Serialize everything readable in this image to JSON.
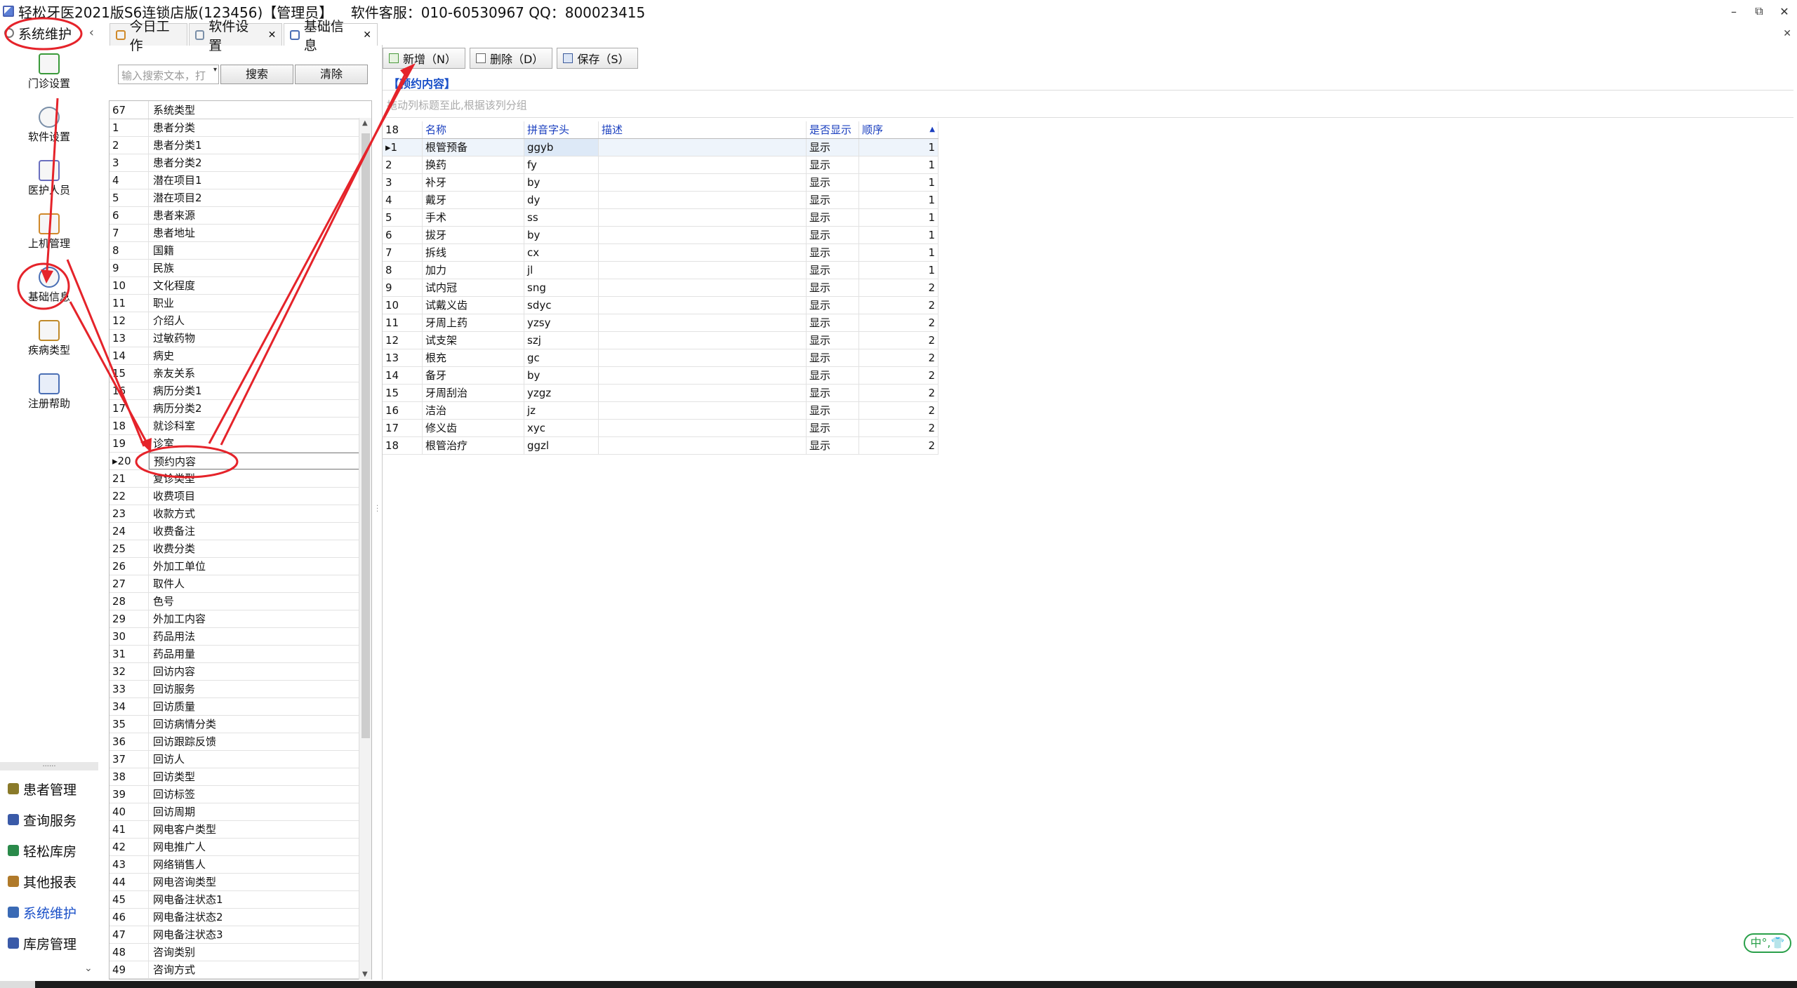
{
  "window": {
    "title": "轻松牙医2021版S6连锁店版(123456)【管理员】    软件客服：010-60530967 QQ：800023415",
    "minimize": "–",
    "restore": "⧉",
    "close": "✕"
  },
  "leftnav": {
    "header": "系统维护",
    "collapse": "‹",
    "tiles": [
      {
        "label": "门诊设置",
        "icon": "house-icon"
      },
      {
        "label": "软件设置",
        "icon": "gear-icon"
      },
      {
        "label": "医护人员",
        "icon": "staff-icon"
      },
      {
        "label": "上机管理",
        "icon": "lock-icon"
      },
      {
        "label": "基础信息",
        "icon": "basic-info-gear-icon"
      },
      {
        "label": "疾病类型",
        "icon": "tree-icon"
      },
      {
        "label": "注册帮助",
        "icon": "help-icon"
      }
    ],
    "splitter": "......",
    "groups": [
      {
        "label": "患者管理",
        "icon": "patients-icon"
      },
      {
        "label": "查询服务",
        "icon": "query-icon"
      },
      {
        "label": "轻松库房",
        "icon": "warehouse-icon"
      },
      {
        "label": "其他报表",
        "icon": "report-icon"
      },
      {
        "label": "系统维护",
        "icon": "maintenance-icon"
      },
      {
        "label": "库房管理",
        "icon": "storage-icon"
      }
    ],
    "more": "⌄"
  },
  "tabs": [
    {
      "label": "今日工作",
      "closable": false
    },
    {
      "label": "软件设置",
      "closable": true
    },
    {
      "label": "基础信息",
      "closable": true
    }
  ],
  "tab_close": "✕",
  "search": {
    "placeholder": "输入搜索文本，打",
    "search_label": "搜索",
    "clear_label": "清除"
  },
  "type_list": {
    "count": "67",
    "header": "系统类型",
    "items": [
      "患者分类",
      "患者分类1",
      "患者分类2",
      "潜在项目1",
      "潜在项目2",
      "患者来源",
      "患者地址",
      "国籍",
      "民族",
      "文化程度",
      "职业",
      "介绍人",
      "过敏药物",
      "病史",
      "亲友关系",
      "病历分类1",
      "病历分类2",
      "就诊科室",
      "诊室",
      "预约内容",
      "复诊类型",
      "收费项目",
      "收款方式",
      "收费备注",
      "收费分类",
      "外加工单位",
      "取件人",
      "色号",
      "外加工内容",
      "药品用法",
      "药品用量",
      "回访内容",
      "回访服务",
      "回访质量",
      "回访病情分类",
      "回访跟踪反馈",
      "回访人",
      "回访类型",
      "回访标签",
      "回访周期",
      "网电客户类型",
      "网电推广人",
      "网络销售人",
      "网电咨询类型",
      "网电备注状态1",
      "网电备注状态2",
      "网电备注状态3",
      "咨询类别",
      "咨询方式"
    ],
    "selected_index": 20
  },
  "toolbar": {
    "add": "新增（N）",
    "delete": "删除（D）",
    "save": "保存（S）"
  },
  "section_title": "【预约内容】",
  "group_hint": "拖动列标题至此,根据该列分组",
  "grid": {
    "count": "18",
    "columns": [
      "名称",
      "拼音字头",
      "描述",
      "是否显示",
      "顺序"
    ],
    "rows": [
      [
        "1",
        "根管预备",
        "ggyb",
        "",
        "显示",
        "1"
      ],
      [
        "2",
        "换药",
        "fy",
        "",
        "显示",
        "1"
      ],
      [
        "3",
        "补牙",
        "by",
        "",
        "显示",
        "1"
      ],
      [
        "4",
        "戴牙",
        "dy",
        "",
        "显示",
        "1"
      ],
      [
        "5",
        "手术",
        "ss",
        "",
        "显示",
        "1"
      ],
      [
        "6",
        "拔牙",
        "by",
        "",
        "显示",
        "1"
      ],
      [
        "7",
        "拆线",
        "cx",
        "",
        "显示",
        "1"
      ],
      [
        "8",
        "加力",
        "jl",
        "",
        "显示",
        "1"
      ],
      [
        "9",
        "试内冠",
        "sng",
        "",
        "显示",
        "2"
      ],
      [
        "10",
        "试戴义齿",
        "sdyc",
        "",
        "显示",
        "2"
      ],
      [
        "11",
        "牙周上药",
        "yzsy",
        "",
        "显示",
        "2"
      ],
      [
        "12",
        "试支架",
        "szj",
        "",
        "显示",
        "2"
      ],
      [
        "13",
        "根充",
        "gc",
        "",
        "显示",
        "2"
      ],
      [
        "14",
        "备牙",
        "by",
        "",
        "显示",
        "2"
      ],
      [
        "15",
        "牙周刮治",
        "yzgz",
        "",
        "显示",
        "2"
      ],
      [
        "16",
        "洁治",
        "jz",
        "",
        "显示",
        "2"
      ],
      [
        "17",
        "修义齿",
        "xyc",
        "",
        "显示",
        "2"
      ],
      [
        "18",
        "根管治疗",
        "ggzl",
        "",
        "显示",
        "2"
      ]
    ],
    "current_row": 1
  },
  "ime": "中°,👕",
  "colors": {
    "accent_blue": "#1a50c8",
    "annotation_red": "#e5232a",
    "ime_green": "#2aa04a"
  }
}
